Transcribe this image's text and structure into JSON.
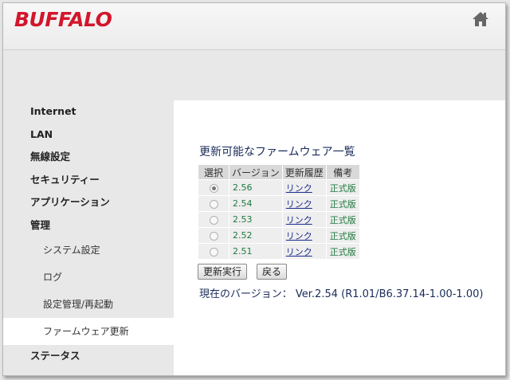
{
  "brand": "BUFFALO",
  "sidebar": {
    "items": [
      "Internet",
      "LAN",
      "無線設定",
      "セキュリティー",
      "アプリケーション",
      "管理"
    ],
    "sub_items": [
      "システム設定",
      "ログ",
      "設定管理/再起動",
      "ファームウェア更新"
    ],
    "active_sub": "ファームウェア更新",
    "status": "ステータス"
  },
  "main": {
    "title": "更新可能なファームウェア一覧",
    "columns": [
      "選択",
      "バージョン",
      "更新履歴",
      "備考"
    ],
    "rows": [
      {
        "selected": true,
        "version": "2.56",
        "history": "リンク",
        "note": "正式版"
      },
      {
        "selected": false,
        "version": "2.54",
        "history": "リンク",
        "note": "正式版"
      },
      {
        "selected": false,
        "version": "2.53",
        "history": "リンク",
        "note": "正式版"
      },
      {
        "selected": false,
        "version": "2.52",
        "history": "リンク",
        "note": "正式版"
      },
      {
        "selected": false,
        "version": "2.51",
        "history": "リンク",
        "note": "正式版"
      }
    ],
    "update_button": "更新実行",
    "back_button": "戻る",
    "current_version_label": "現在のバージョン：",
    "current_version": "Ver.2.54 (R1.01/B6.37.14-1.00-1.00)"
  },
  "colors": {
    "brand": "#d2162b",
    "link": "#1a2b8a",
    "note": "#1f7a3e"
  }
}
